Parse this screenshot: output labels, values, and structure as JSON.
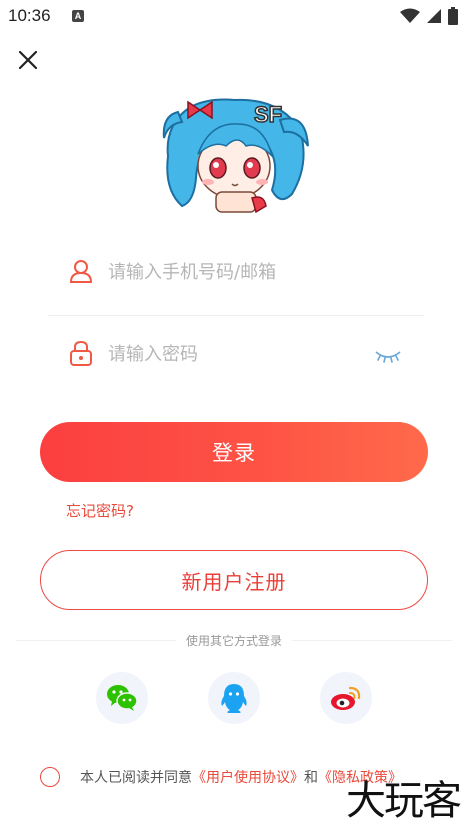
{
  "status_bar": {
    "time": "10:36",
    "badge": "A"
  },
  "login": {
    "account_placeholder": "请输入手机号码/邮箱",
    "password_placeholder": "请输入密码",
    "login_label": "登录",
    "forgot_label": "忘记密码?",
    "register_label": "新用户注册",
    "other_methods_label": "使用其它方式登录"
  },
  "social": [
    {
      "name": "wechat-icon"
    },
    {
      "name": "qq-icon"
    },
    {
      "name": "weibo-icon"
    }
  ],
  "agreement": {
    "prefix": "本人已阅读并同意",
    "user_agreement": "《用户使用协议》",
    "conjunction": "和",
    "privacy_policy": "《隐私政策》"
  },
  "watermark": "大玩客",
  "colors": {
    "accent": "#fb4a3f",
    "wechat": "#2dc100",
    "qq": "#1ba2f1",
    "weibo": "#e6162d"
  }
}
